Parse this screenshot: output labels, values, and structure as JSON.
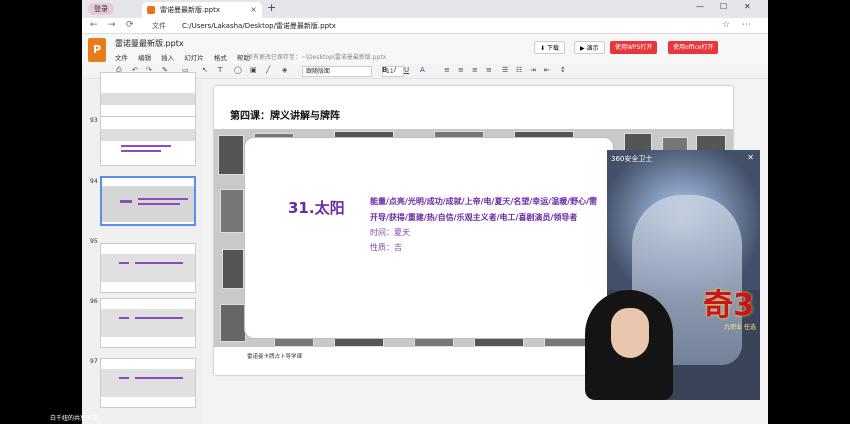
{
  "browser": {
    "profile_label": "登录",
    "tab_title": "雷诺曼最新版.pptx",
    "new_tab": "+",
    "file_label": "文件",
    "url": "C:/Users/Lakasha/Desktop/雷诺曼最新版.pptx",
    "window_minimize": "—",
    "window_maximize": "☐",
    "window_close": "✕"
  },
  "app": {
    "logo": "P",
    "doc_title": "雷诺曼最新版.pptx",
    "menus": [
      "文件",
      "编辑",
      "插入",
      "幻灯片",
      "格式",
      "帮助"
    ],
    "saved_note": "所有更改已保存至：~\\Desktop\\雷诺曼最新版.pptx",
    "download_label": "下载",
    "present_label": "演示",
    "wps_label": "使用WPS打开",
    "office_label": "使用office打开",
    "font_name": "跟随版面",
    "font_size": "11"
  },
  "thumbnails": {
    "numbers": [
      "93",
      "94",
      "95",
      "96",
      "97"
    ],
    "active": "94"
  },
  "slide": {
    "lesson_title": "第四课：牌义讲解与牌阵",
    "card_title": "31.太阳",
    "keywords_line1": "能量/点亮/光明/成功/成就/上帝/电/夏天/名望/幸运/温暖/野心/需",
    "keywords_line2": "开导/获得/重建/热/自信/乐观主义者/电工/喜剧演员/领导者",
    "time_line": "时间：夏天",
    "nature_line": "性质：吉",
    "footer": "雷诺曼卡牌占卜导学课"
  },
  "video": {
    "header": "360安全卫士",
    "close": "✕",
    "game_logo": "奇3",
    "game_sub": "九职业 任选"
  },
  "caption": "白千纽的共享屏幕",
  "colors": {
    "accent_purple": "#6a2aa7",
    "app_orange": "#e87b1a",
    "wps_red": "#e8363d"
  }
}
